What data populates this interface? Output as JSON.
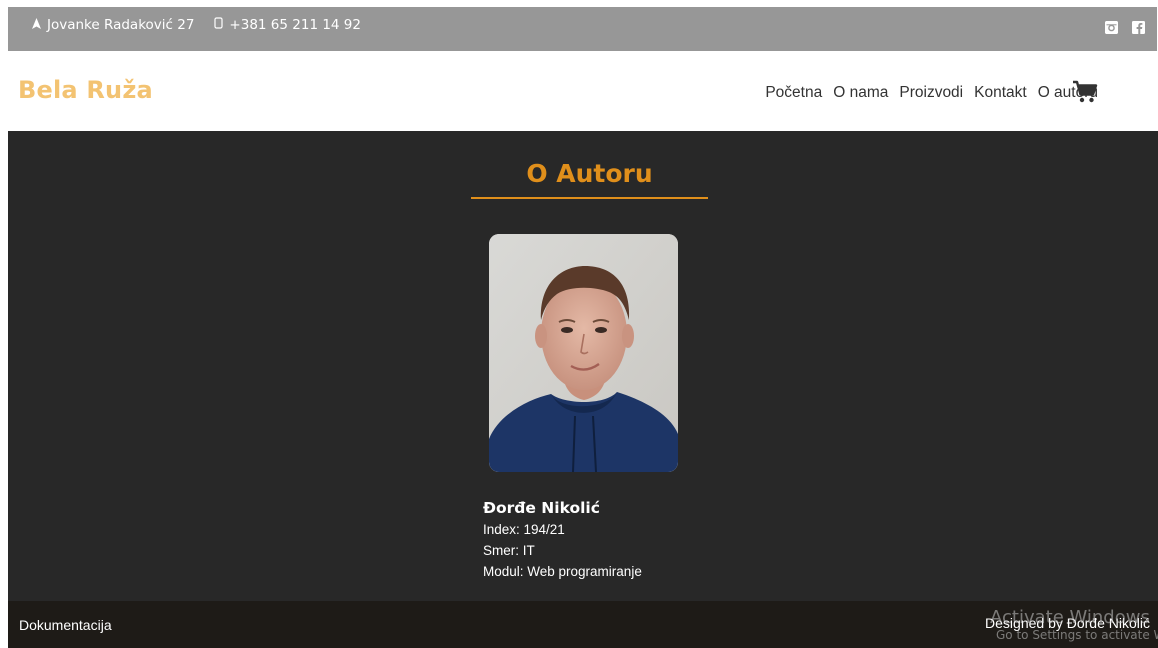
{
  "topbar": {
    "address": "Jovanke Radaković 27",
    "phone": "+381 65 211 14 92",
    "icons": [
      "location-icon",
      "phone-icon",
      "instagram-icon",
      "facebook-icon"
    ]
  },
  "nav": {
    "brand": "Bela Ruža",
    "items": [
      "Početna",
      "O nama",
      "Proizvodi",
      "Kontakt",
      "O autoru"
    ],
    "cart_icon": "cart-icon"
  },
  "main": {
    "heading": "O Autoru",
    "author": {
      "name": "Đorđe Nikolić",
      "index": "Index: 194/21",
      "major": "Smer: IT",
      "module": "Modul: Web programiranje"
    }
  },
  "footer": {
    "docs": "Dokumentacija",
    "designed": "Designed by Đorđe Nikolić"
  },
  "watermark": {
    "line1": "Activate Windows",
    "line2": "Go to Settings to activate Windows."
  },
  "colors": {
    "brand": "#f3c372",
    "accent": "#e08f1b",
    "topbar": "#979797",
    "main_bg": "#282828",
    "footer_bg": "#1e1b17"
  }
}
